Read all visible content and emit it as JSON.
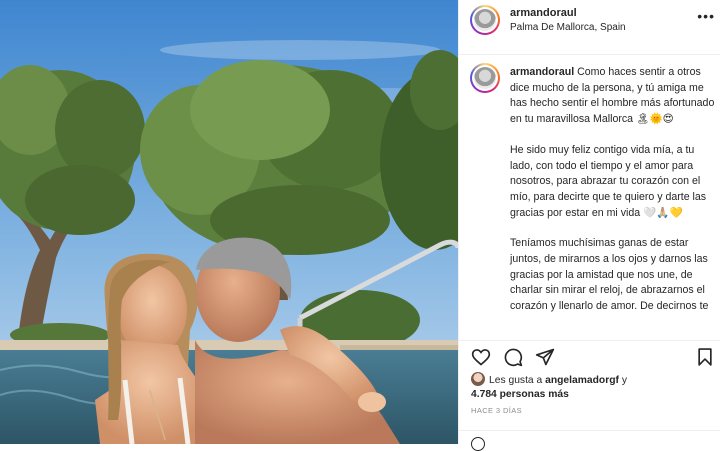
{
  "post": {
    "username": "armandoraul",
    "location": "Palma De Mallorca, Spain"
  },
  "caption": {
    "username": "armandoraul",
    "paragraph1": "Como haces sentir a otros dice mucho de la persona, y tú amiga me has hecho sentir el hombre más afortunado en tu maravillosa Mallorca 🏝🌞😍",
    "paragraph2": "He sido muy feliz contigo vida mía, a tu lado, con todo el tiempo y el amor para nosotros, para abrazar tu corazón con el mío, para decirte que te quiero y darte las gracias por estar en mi vida 🤍🙏🏼💛",
    "paragraph3": "Teníamos muchísimas ganas de estar juntos, de mirarnos a los ojos y darnos las gracias por la amistad que nos une, de charlar sin mirar el reloj, de abrazarnos el corazón y llenarlo de amor. De decirnos te"
  },
  "likes": {
    "prefix": "Les gusta a",
    "user": "angelamadorgf",
    "connector": "y",
    "count_text": "4.784 personas más"
  },
  "timestamp": "HACE 3 DÍAS",
  "icons": {
    "more": "more-options-icon",
    "like": "heart-icon",
    "comment": "comment-icon",
    "share": "share-icon",
    "save": "bookmark-icon"
  }
}
